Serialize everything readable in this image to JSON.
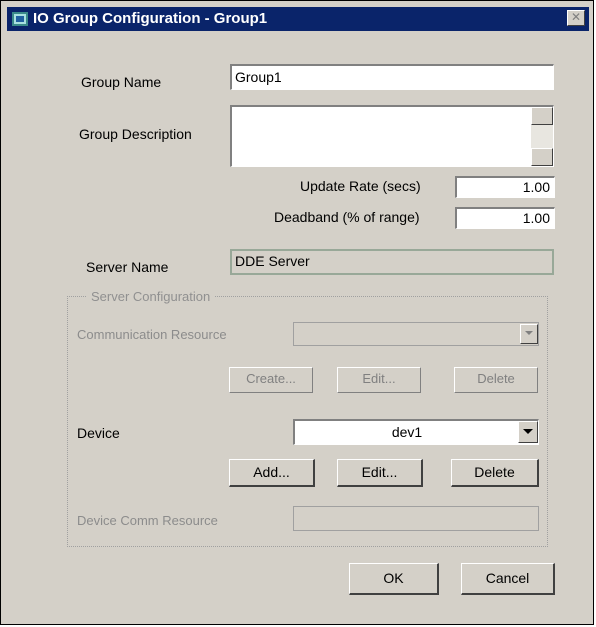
{
  "window": {
    "title": "IO Group Configuration - Group1"
  },
  "form": {
    "group_name_label": "Group Name",
    "group_name_value": "Group1",
    "group_description_label": "Group Description",
    "group_description_value": "",
    "update_rate_label": "Update Rate (secs)",
    "update_rate_value": "1.00",
    "deadband_label": "Deadband (% of range)",
    "deadband_value": "1.00",
    "server_name_label": "Server Name",
    "server_name_value": "DDE Server"
  },
  "server_config": {
    "legend": "Server Configuration",
    "comm_resource_label": "Communication Resource",
    "comm_resource_value": "",
    "create_label": "Create...",
    "edit_label": "Edit...",
    "delete_label": "Delete",
    "device_label": "Device",
    "device_value": "dev1",
    "add_label": "Add...",
    "device_edit_label": "Edit...",
    "device_delete_label": "Delete",
    "device_comm_resource_label": "Device Comm Resource",
    "device_comm_resource_value": ""
  },
  "footer": {
    "ok_label": "OK",
    "cancel_label": "Cancel"
  },
  "colors": {
    "titlebar": "#0a246a",
    "dialog_bg": "#d4d0c8"
  }
}
